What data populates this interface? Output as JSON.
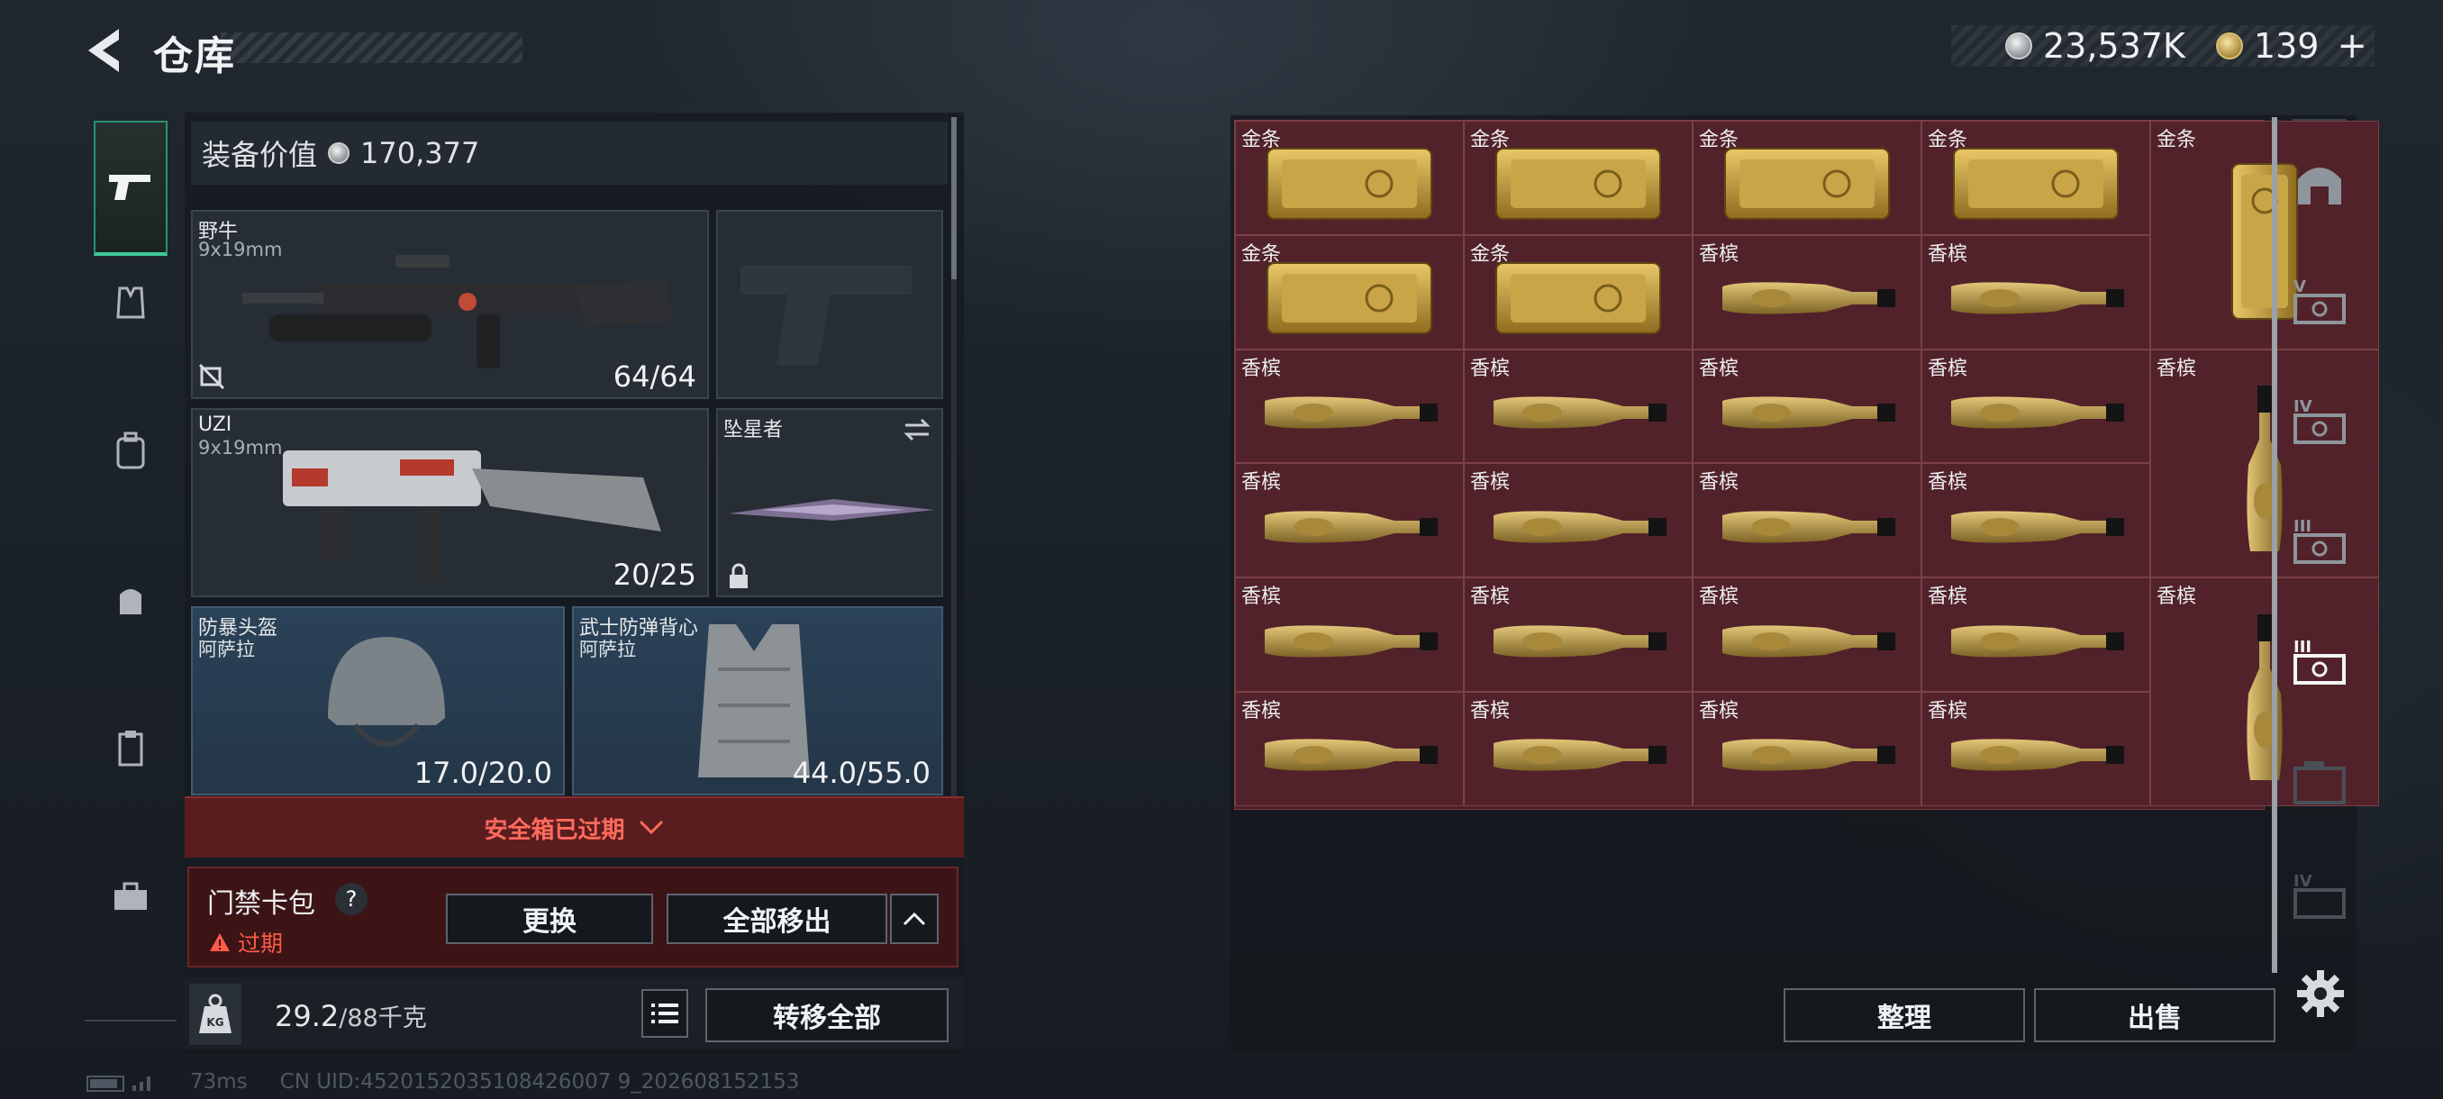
{
  "header": {
    "title": "仓库",
    "currencies": [
      {
        "icon": "silver-coin-icon",
        "value": "23,537K"
      },
      {
        "icon": "gold-token-icon",
        "value": "139"
      }
    ],
    "plus": "+"
  },
  "categories": [
    {
      "name": "pistol-icon",
      "active": true
    },
    {
      "name": "vest-icon",
      "active": false
    },
    {
      "name": "backpack-icon",
      "active": false
    },
    {
      "name": "bag-icon",
      "active": false
    },
    {
      "name": "clipboard-icon",
      "active": false
    },
    {
      "name": "toolbox-icon",
      "active": false
    }
  ],
  "loadout": {
    "value_label": "装备价值",
    "value": "170,377",
    "primary": {
      "name": "野牛",
      "caliber": "9x19mm",
      "ammo": "64/64"
    },
    "secondary": {
      "name": "UZI",
      "caliber": "9x19mm",
      "ammo": "20/25"
    },
    "melee": {
      "name": "坠星者"
    },
    "helmet": {
      "name": "防暴头盔",
      "sub": "阿萨拉",
      "durability": "17.0/20.0"
    },
    "vest": {
      "name": "武士防弹背心",
      "sub": "阿萨拉",
      "durability": "44.0/55.0"
    },
    "safebox_expired": "安全箱已过期",
    "case": {
      "name": "门禁卡包",
      "help": "?",
      "status": "过期",
      "replace": "更换",
      "remove_all": "全部移出"
    },
    "weight": {
      "current": "29.2",
      "max_unit": "/88千克",
      "kg": "KG"
    },
    "transfer_all": "转移全部"
  },
  "status": {
    "ping": "73ms",
    "uid": "CN UID:4520152035108426007 9_202608152153"
  },
  "stash": {
    "labels": {
      "gold": "金条",
      "champagne": "香槟"
    },
    "items": [
      {
        "type": "gold",
        "label": "金条",
        "col": 0,
        "row": 0,
        "w": 1,
        "h": 1
      },
      {
        "type": "gold",
        "label": "金条",
        "col": 1,
        "row": 0,
        "w": 1,
        "h": 1
      },
      {
        "type": "gold",
        "label": "金条",
        "col": 2,
        "row": 0,
        "w": 1,
        "h": 1
      },
      {
        "type": "gold",
        "label": "金条",
        "col": 3,
        "row": 0,
        "w": 1,
        "h": 1
      },
      {
        "type": "gold",
        "label": "金条",
        "col": 4,
        "row": 0,
        "w": 1,
        "h": 2
      },
      {
        "type": "gold",
        "label": "金条",
        "col": 0,
        "row": 1,
        "w": 1,
        "h": 1
      },
      {
        "type": "gold",
        "label": "金条",
        "col": 1,
        "row": 1,
        "w": 1,
        "h": 1
      },
      {
        "type": "champagne",
        "label": "香槟",
        "col": 2,
        "row": 1,
        "w": 1,
        "h": 1
      },
      {
        "type": "champagne",
        "label": "香槟",
        "col": 3,
        "row": 1,
        "w": 1,
        "h": 1
      },
      {
        "type": "champagne",
        "label": "香槟",
        "col": 0,
        "row": 2,
        "w": 1,
        "h": 1
      },
      {
        "type": "champagne",
        "label": "香槟",
        "col": 1,
        "row": 2,
        "w": 1,
        "h": 1
      },
      {
        "type": "champagne",
        "label": "香槟",
        "col": 2,
        "row": 2,
        "w": 1,
        "h": 1
      },
      {
        "type": "champagne",
        "label": "香槟",
        "col": 3,
        "row": 2,
        "w": 1,
        "h": 1
      },
      {
        "type": "champagne",
        "label": "香槟",
        "col": 4,
        "row": 2,
        "w": 1,
        "h": 2
      },
      {
        "type": "champagne",
        "label": "香槟",
        "col": 0,
        "row": 3,
        "w": 1,
        "h": 1
      },
      {
        "type": "champagne",
        "label": "香槟",
        "col": 1,
        "row": 3,
        "w": 1,
        "h": 1
      },
      {
        "type": "champagne",
        "label": "香槟",
        "col": 2,
        "row": 3,
        "w": 1,
        "h": 1
      },
      {
        "type": "champagne",
        "label": "香槟",
        "col": 3,
        "row": 3,
        "w": 1,
        "h": 1
      },
      {
        "type": "champagne",
        "label": "香槟",
        "col": 0,
        "row": 4,
        "w": 1,
        "h": 1
      },
      {
        "type": "champagne",
        "label": "香槟",
        "col": 1,
        "row": 4,
        "w": 1,
        "h": 1
      },
      {
        "type": "champagne",
        "label": "香槟",
        "col": 2,
        "row": 4,
        "w": 1,
        "h": 1
      },
      {
        "type": "champagne",
        "label": "香槟",
        "col": 3,
        "row": 4,
        "w": 1,
        "h": 1
      },
      {
        "type": "champagne",
        "label": "香槟",
        "col": 4,
        "row": 4,
        "w": 1,
        "h": 2
      },
      {
        "type": "champagne",
        "label": "香槟",
        "col": 0,
        "row": 5,
        "w": 1,
        "h": 1
      },
      {
        "type": "champagne",
        "label": "香槟",
        "col": 1,
        "row": 5,
        "w": 1,
        "h": 1
      },
      {
        "type": "champagne",
        "label": "香槟",
        "col": 2,
        "row": 5,
        "w": 1,
        "h": 1
      },
      {
        "type": "champagne",
        "label": "香槟",
        "col": 3,
        "row": 5,
        "w": 1,
        "h": 1
      }
    ],
    "sort_label": "整理",
    "sell_label": "出售"
  },
  "side_tabs": [
    {
      "name": "safe-house-icon"
    },
    {
      "name": "container-v-icon",
      "roman": "V"
    },
    {
      "name": "container-iv-icon",
      "roman": "IV"
    },
    {
      "name": "container-iii-icon",
      "roman": "III"
    },
    {
      "name": "container-iii-active-icon",
      "roman": "III"
    },
    {
      "name": "container-ii-icon",
      "roman": ""
    },
    {
      "name": "container-iv-b-icon",
      "roman": "IV"
    }
  ],
  "colors": {
    "accent_green": "#3fc899",
    "expired_red": "#ff5a4a",
    "stash_cell": "#52222a"
  }
}
